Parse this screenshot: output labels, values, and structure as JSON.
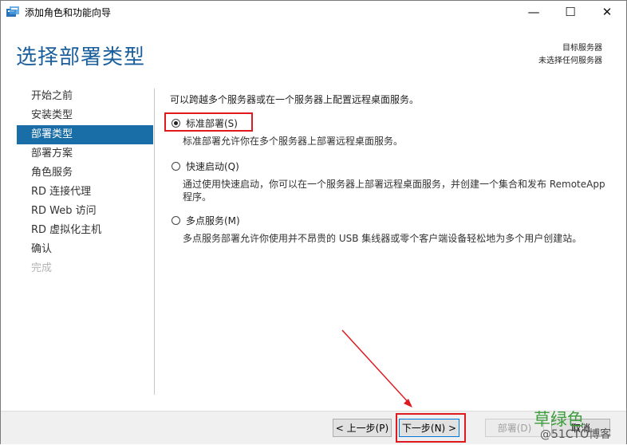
{
  "window": {
    "title": "添加角色和功能向导",
    "minimize": "—",
    "maximize": "☐",
    "close": "✕"
  },
  "header": {
    "title": "选择部署类型",
    "destination_label": "目标服务器",
    "destination_value": "未选择任何服务器"
  },
  "sidebar": {
    "items": [
      {
        "label": "开始之前",
        "state": "normal"
      },
      {
        "label": "安装类型",
        "state": "normal"
      },
      {
        "label": "部署类型",
        "state": "active"
      },
      {
        "label": "部署方案",
        "state": "normal"
      },
      {
        "label": "角色服务",
        "state": "normal"
      },
      {
        "label": "RD 连接代理",
        "state": "normal"
      },
      {
        "label": "RD Web 访问",
        "state": "normal"
      },
      {
        "label": "RD 虚拟化主机",
        "state": "normal"
      },
      {
        "label": "确认",
        "state": "normal"
      },
      {
        "label": "完成",
        "state": "disabled"
      }
    ]
  },
  "content": {
    "intro": "可以跨越多个服务器或在一个服务器上配置远程桌面服务。",
    "options": [
      {
        "label": "标准部署(S)",
        "checked": true,
        "description": "标准部署允许你在多个服务器上部署远程桌面服务。"
      },
      {
        "label": "快速启动(Q)",
        "checked": false,
        "description": "通过使用快速启动，你可以在一个服务器上部署远程桌面服务，并创建一个集合和发布 RemoteApp 程序。"
      },
      {
        "label": "多点服务(M)",
        "checked": false,
        "description": "多点服务部署允许你使用并不昂贵的 USB 集线器或零个客户端设备轻松地为多个用户创建站。"
      }
    ]
  },
  "footer": {
    "prev_label": "< 上一步(P)",
    "next_label": "下一步(N) >",
    "deploy_label": "部署(D)",
    "cancel_label": "取消"
  },
  "watermark": {
    "big": "草绿色",
    "small": "@51CTO博客"
  },
  "colors": {
    "accent": "#1a6ea8",
    "title": "#1a5f9c",
    "highlight": "#e0191e"
  }
}
